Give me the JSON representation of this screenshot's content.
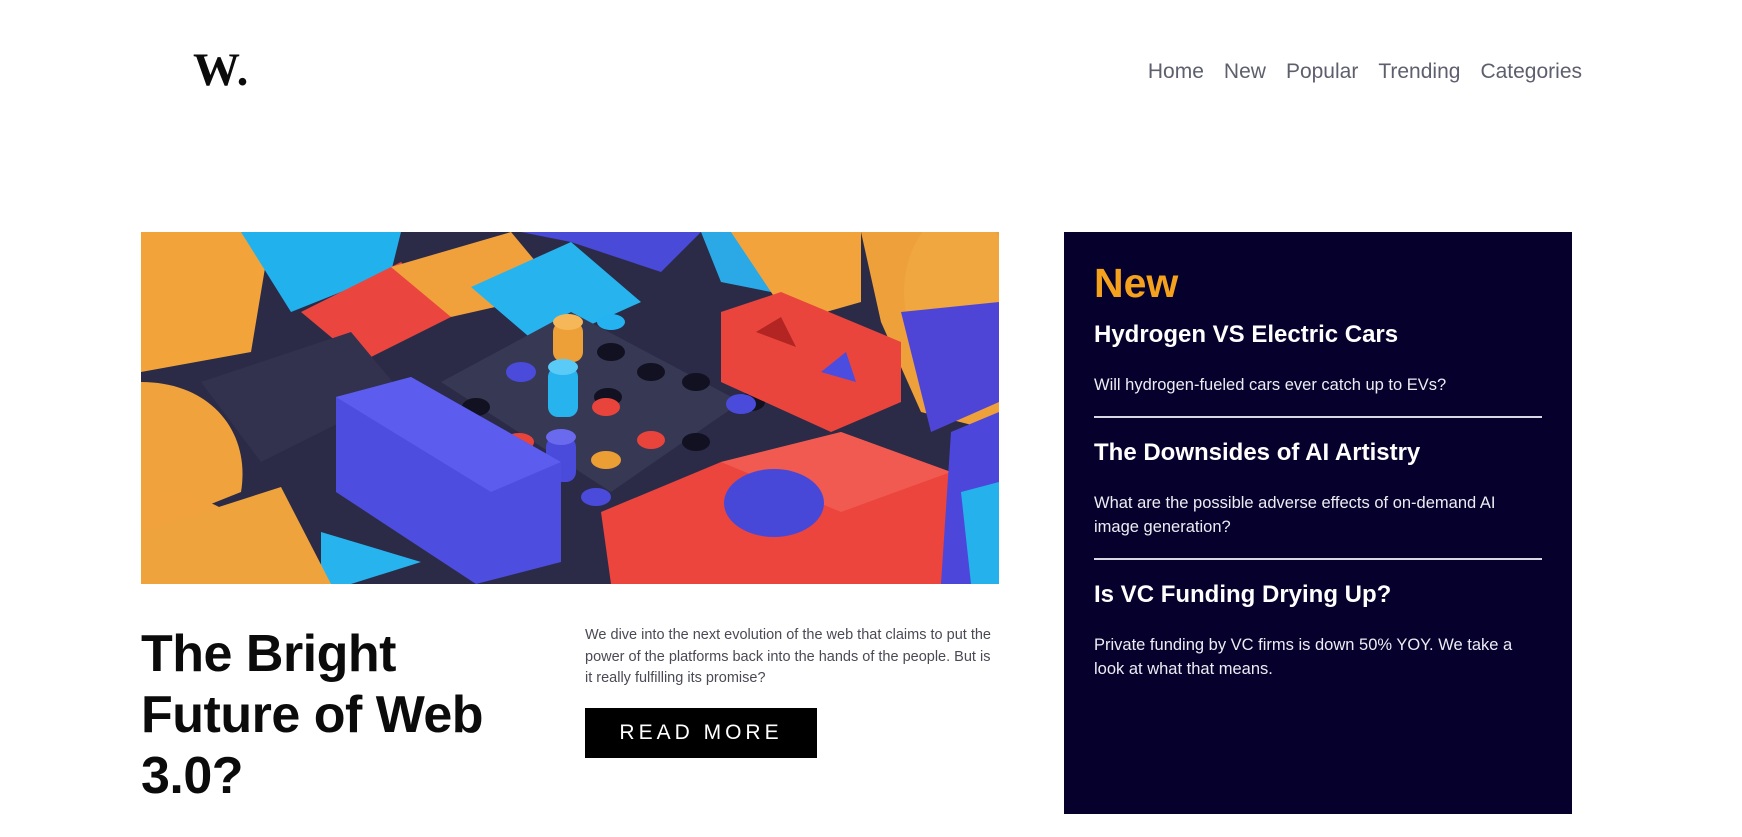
{
  "header": {
    "logo": "W.",
    "nav": [
      "Home",
      "New",
      "Popular",
      "Trending",
      "Categories"
    ]
  },
  "hero": {
    "image_alt": "colorful 3D geometric blocks",
    "title": "The Bright Future of Web 3.0?",
    "description": "We dive into the next evolution of the web that claims to put the power of the platforms back into the hands of the people. But is it really fulfilling its promise?",
    "cta_label": "READ MORE"
  },
  "new_panel": {
    "heading": "New",
    "articles": [
      {
        "title": "Hydrogen VS Electric Cars",
        "description": "Will hydrogen-fueled cars ever catch up to EVs?"
      },
      {
        "title": "The Downsides of AI Artistry",
        "description": "What are the possible adverse effects of on-demand AI image generation?"
      },
      {
        "title": "Is VC Funding Drying Up?",
        "description": "Private funding by VC firms is down 50% YOY. We take a look at what that means."
      }
    ]
  },
  "colors": {
    "accent": "#f4a11d",
    "panel_bg": "#06002c",
    "button_bg": "#000000",
    "nav_text": "#5d5f6d"
  }
}
